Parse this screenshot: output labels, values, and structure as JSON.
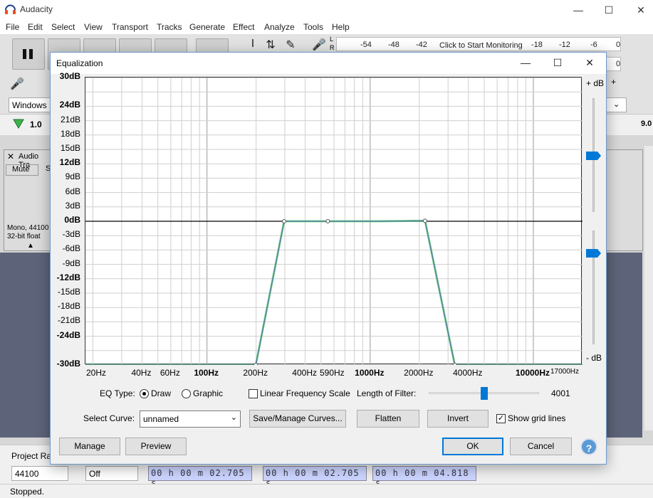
{
  "app": {
    "title": "Audacity",
    "menu": [
      "File",
      "Edit",
      "Select",
      "View",
      "Transport",
      "Tracks",
      "Generate",
      "Effect",
      "Analyze",
      "Tools",
      "Help"
    ],
    "meter": {
      "ticks": [
        "-54",
        "-48",
        "-42",
        "-18",
        "-12",
        "-6",
        "0"
      ],
      "ticks2": [
        "0"
      ],
      "monitor_label": "Click to Start Monitoring",
      "lr": [
        "L",
        "R"
      ]
    },
    "device_host": "Windows",
    "play_speed": "1.0",
    "timeline_right": "9.0",
    "track": {
      "name": "Audio Tra",
      "mute": "Mute",
      "solo": "S",
      "info_line1": "Mono, 44100",
      "info_line2": "32-bit float"
    },
    "project_rate_label": "Project Ra",
    "project_rate": "44100",
    "snap_to": "Off",
    "times": [
      "00 h 00 m 02.705 s",
      "00 h 00 m 02.705 s",
      "00 h 00 m 04.818 s"
    ],
    "status": "Stopped."
  },
  "dialog": {
    "title": "Equalization",
    "db_top": "+ dB",
    "db_bottom": "- dB",
    "eq_type_label": "EQ Type:",
    "eq_draw": "Draw",
    "eq_graphic": "Graphic",
    "linear_freq": "Linear Frequency Scale",
    "filter_length_label": "Length of Filter:",
    "filter_length": "4001",
    "filter_length_fraction": 0.5,
    "select_curve_label": "Select Curve:",
    "select_curve_value": "unnamed",
    "save_manage": "Save/Manage Curves...",
    "flatten": "Flatten",
    "invert": "Invert",
    "show_grid": "Show grid lines",
    "manage": "Manage",
    "preview": "Preview",
    "ok": "OK",
    "cancel": "Cancel",
    "help": "?"
  },
  "chart_data": {
    "type": "line",
    "y_ticks": [
      "30dB",
      "24dB",
      "21dB",
      "18dB",
      "15dB",
      "12dB",
      "9dB",
      "6dB",
      "3dB",
      "0dB",
      "-3dB",
      "-6dB",
      "-9dB",
      "-12dB",
      "-15dB",
      "-18dB",
      "-21dB",
      "-24dB",
      "-30dB"
    ],
    "y_ticks_bold": [
      "30dB",
      "24dB",
      "12dB",
      "0dB",
      "-12dB",
      "-24dB",
      "-30dB"
    ],
    "x_ticks": [
      "20Hz",
      "40Hz",
      "60Hz",
      "100Hz",
      "200Hz",
      "400Hz",
      "590Hz",
      "1000Hz",
      "2000Hz",
      "4000Hz",
      "10000Hz",
      "17000Hz"
    ],
    "x_ticks_bold": [
      "100Hz",
      "1000Hz",
      "10000Hz"
    ],
    "x_scale": "log",
    "xlim": [
      18,
      20000
    ],
    "ylim": [
      -30,
      30
    ],
    "grid": true,
    "series": [
      {
        "x": [
          18,
          199,
          297,
          550,
          1100,
          2170,
          3300,
          20000
        ],
        "y": [
          -30,
          -30,
          0,
          0,
          0,
          0.1,
          -30,
          -30
        ],
        "color": "#5b7fa4"
      }
    ],
    "control_points_x": [
      199,
      297,
      550,
      2170,
      3300
    ]
  }
}
